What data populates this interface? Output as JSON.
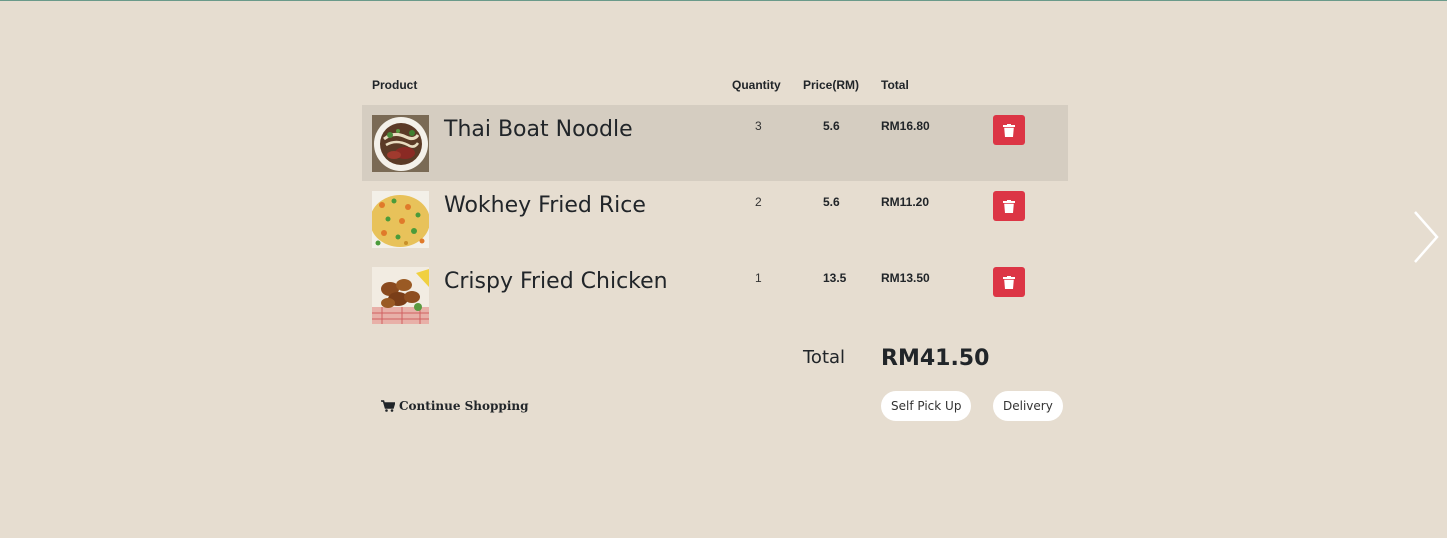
{
  "table": {
    "headers": {
      "product": "Product",
      "quantity": "Quantity",
      "price": "Price(RM)",
      "total": "Total"
    }
  },
  "items": [
    {
      "name": "Thai Boat Noodle",
      "quantity": "3",
      "price": "5.6",
      "total": "RM16.80"
    },
    {
      "name": "Wokhey Fried Rice",
      "quantity": "2",
      "price": "5.6",
      "total": "RM11.20"
    },
    {
      "name": "Crispy Fried Chicken",
      "quantity": "1",
      "price": "13.5",
      "total": "RM13.50"
    }
  ],
  "summary": {
    "total_label": "Total",
    "total_value": "RM41.50"
  },
  "actions": {
    "continue_shopping": "Continue Shopping",
    "self_pick_up": "Self Pick Up",
    "delivery": "Delivery"
  },
  "icons": {
    "delete": "trash-icon",
    "cart": "cart-icon",
    "next": "chevron-right-icon"
  },
  "colors": {
    "background": "#e6ddd0",
    "highlight_row": "#d5cdc1",
    "delete_button": "#dc3545",
    "pill_background": "#ffffff"
  }
}
